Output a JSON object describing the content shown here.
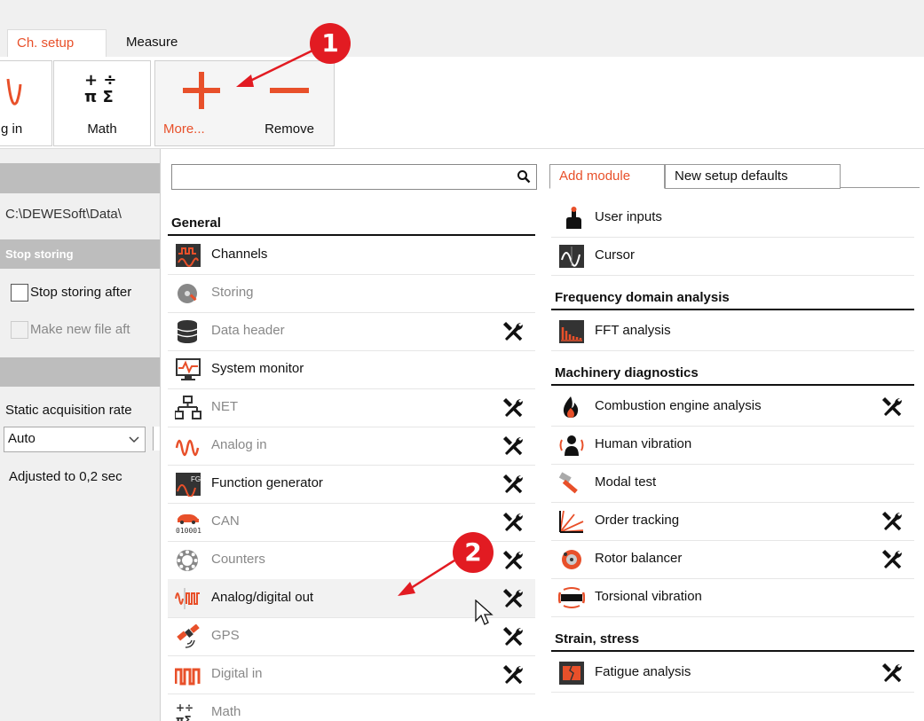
{
  "tabs": [
    {
      "label": "Ch. setup"
    },
    {
      "label": "Measure"
    }
  ],
  "ribbon": {
    "analog_in": "g in",
    "math": "Math",
    "more": "More...",
    "remove": "Remove"
  },
  "left_panel": {
    "path": "C:\\DEWESoft\\Data\\",
    "stop_storing_header": "Stop storing",
    "stop_storing_after": "Stop storing after",
    "make_new_file": "Make new file aft",
    "static_rate_label": "Static acquisition rate",
    "rate_value": "Auto",
    "adjusted": "Adjusted to 0,2 sec"
  },
  "menu": {
    "search_placeholder": "",
    "tabs": [
      {
        "label": "Add module"
      },
      {
        "label": "New setup defaults"
      }
    ],
    "left": {
      "section": "General",
      "items": [
        {
          "label": "Channels",
          "enabled": true,
          "tool": false,
          "icon": "channels-icon"
        },
        {
          "label": "Storing",
          "enabled": false,
          "tool": false,
          "icon": "storing-icon"
        },
        {
          "label": "Data header",
          "enabled": false,
          "tool": true,
          "icon": "database-icon"
        },
        {
          "label": "System monitor",
          "enabled": true,
          "tool": false,
          "icon": "monitor-icon"
        },
        {
          "label": "NET",
          "enabled": false,
          "tool": true,
          "icon": "network-icon"
        },
        {
          "label": "Analog in",
          "enabled": false,
          "tool": true,
          "icon": "sine-wave-icon"
        },
        {
          "label": "Function generator",
          "enabled": true,
          "tool": true,
          "icon": "function-generator-icon"
        },
        {
          "label": "CAN",
          "enabled": false,
          "tool": true,
          "icon": "can-icon"
        },
        {
          "label": "Counters",
          "enabled": false,
          "tool": true,
          "icon": "counter-icon"
        },
        {
          "label": "Analog/digital out",
          "enabled": true,
          "tool": true,
          "icon": "analog-digital-out-icon"
        },
        {
          "label": "GPS",
          "enabled": false,
          "tool": true,
          "icon": "satellite-icon"
        },
        {
          "label": "Digital in",
          "enabled": false,
          "tool": true,
          "icon": "digital-in-icon"
        },
        {
          "label": "Math",
          "enabled": false,
          "tool": false,
          "icon": "math-icon"
        }
      ]
    },
    "right": [
      {
        "section": null,
        "items": [
          {
            "label": "User inputs",
            "tool": false,
            "icon": "user-input-icon"
          },
          {
            "label": "Cursor",
            "tool": false,
            "icon": "cursor-icon"
          }
        ]
      },
      {
        "section": "Frequency domain analysis",
        "items": [
          {
            "label": "FFT analysis",
            "tool": false,
            "icon": "fft-icon"
          }
        ]
      },
      {
        "section": "Machinery diagnostics",
        "items": [
          {
            "label": "Combustion engine analysis",
            "tool": true,
            "icon": "flame-icon"
          },
          {
            "label": "Human vibration",
            "tool": false,
            "icon": "human-vibration-icon"
          },
          {
            "label": "Modal test",
            "tool": false,
            "icon": "hammer-icon"
          },
          {
            "label": "Order tracking",
            "tool": true,
            "icon": "order-tracking-icon"
          },
          {
            "label": "Rotor balancer",
            "tool": true,
            "icon": "rotor-icon"
          },
          {
            "label": "Torsional vibration",
            "tool": false,
            "icon": "torsional-icon"
          }
        ]
      },
      {
        "section": "Strain, stress",
        "items": [
          {
            "label": "Fatigue analysis",
            "tool": true,
            "icon": "fatigue-icon"
          }
        ]
      }
    ]
  },
  "annotations": [
    {
      "label": "1"
    },
    {
      "label": "2"
    }
  ],
  "colors": {
    "accent": "#e8502a",
    "badge": "#e21b22",
    "icon_bg": "#333333"
  }
}
